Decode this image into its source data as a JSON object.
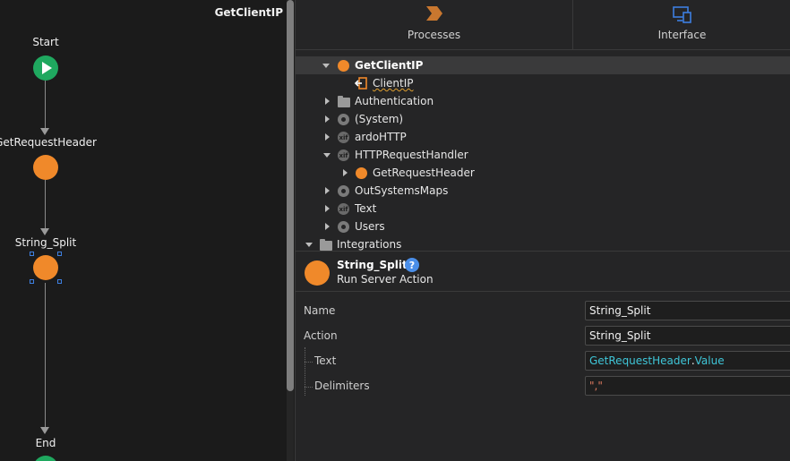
{
  "canvas": {
    "title": "GetClientIP",
    "nodes": {
      "start": "Start",
      "get_request_header": "GetRequestHeader",
      "string_split": "String_Split",
      "end": "End"
    }
  },
  "tabs": [
    {
      "label": "Processes",
      "icon": "processes-icon",
      "color": "#c9772f"
    },
    {
      "label": "Interface",
      "icon": "interface-icon",
      "color": "#3d7fe0"
    }
  ],
  "tree": {
    "action": "GetClientIP",
    "output_param": "ClientIP",
    "items": [
      "Authentication",
      "(System)",
      "ardoHTTP",
      "HTTPRequestHandler",
      "GetRequestHeader",
      "OutSystemsMaps",
      "Text",
      "Users",
      "Integrations"
    ]
  },
  "properties": {
    "title": "String_Split",
    "subtitle": "Run Server Action",
    "help": "?",
    "rows": [
      {
        "label": "Name",
        "value": "String_Split"
      },
      {
        "label": "Action",
        "value": "String_Split"
      },
      {
        "label": "Text",
        "value_a": "GetRequestHeader",
        "value_sep": ".",
        "value_b": "Value"
      },
      {
        "label": "Delimiters",
        "value": "\",\""
      }
    ]
  },
  "colors": {
    "accent_orange": "#f0892a",
    "start_green": "#1fa85f",
    "expression_cyan": "#3fc6d8",
    "selection_blue": "#3d7fe0"
  }
}
